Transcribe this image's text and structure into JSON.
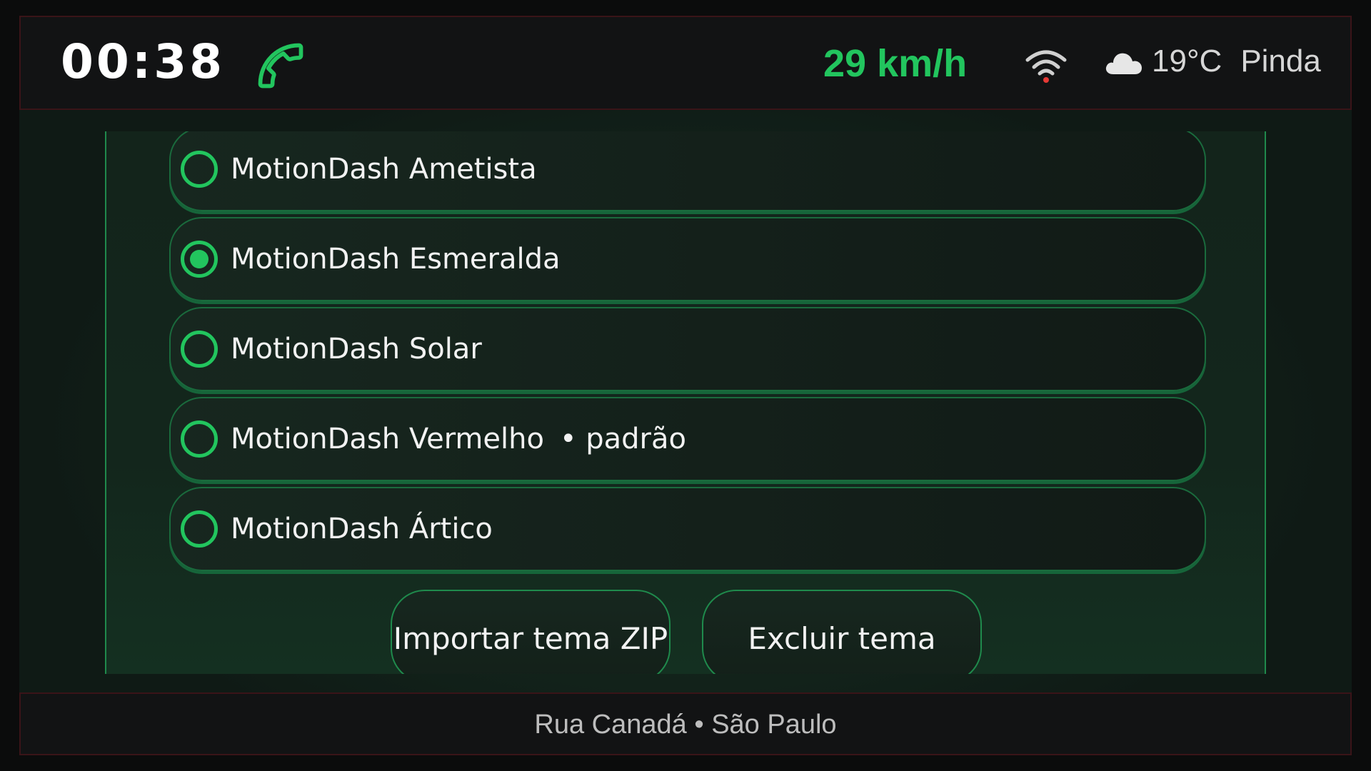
{
  "status_bar": {
    "time": "00:38",
    "speed": "29 km/h",
    "temperature": "19°C",
    "city": "Pinda",
    "icons": {
      "phone": "phone-icon",
      "wifi": "wifi-icon",
      "weather": "cloud-icon"
    },
    "accent_color": "#22c55e"
  },
  "themes": {
    "items": [
      {
        "label": "MotionDash Ametista",
        "selected": false,
        "badge": ""
      },
      {
        "label": "MotionDash Esmeralda",
        "selected": true,
        "badge": ""
      },
      {
        "label": "MotionDash Solar",
        "selected": false,
        "badge": ""
      },
      {
        "label": "MotionDash Vermelho",
        "selected": false,
        "badge": "• padrão"
      },
      {
        "label": "MotionDash Ártico",
        "selected": false,
        "badge": ""
      }
    ]
  },
  "actions": {
    "import_label": "Importar tema ZIP",
    "delete_label": "Excluir tema"
  },
  "footer": {
    "address": "Rua Canadá • São Paulo"
  }
}
